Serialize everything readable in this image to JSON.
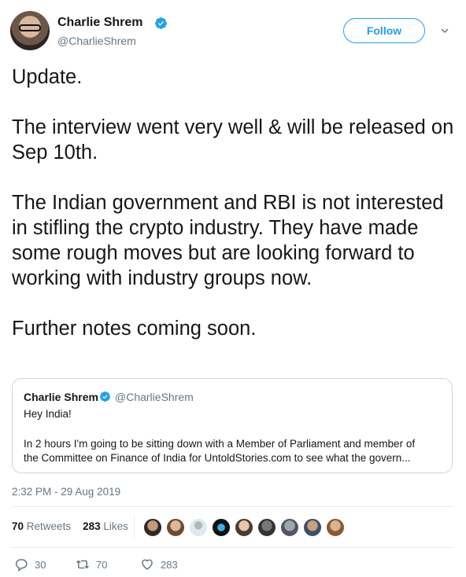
{
  "author": {
    "name": "Charlie Shrem",
    "handle": "@CharlieShrem",
    "verified": true
  },
  "follow_label": "Follow",
  "tweet": {
    "paragraphs": [
      "Update.",
      "The interview went very well & will be released on Sep 10th.",
      "The Indian government and RBI is not interested in stifling the crypto industry. They have made some rough moves but are looking forward to working with industry groups now.",
      "Further notes coming soon."
    ],
    "timestamp": "2:32 PM - 29 Aug 2019"
  },
  "quoted": {
    "name": "Charlie Shrem",
    "handle": "@CharlieShrem",
    "line1": "Hey India!",
    "line2": "In 2 hours I'm going to be sitting down with a Member of Parliament and member of",
    "line3": "the Committee on Finance of India for UntoldStories.com to see what the govern..."
  },
  "stats": {
    "retweets_count": "70",
    "retweets_label": "Retweets",
    "likes_count": "283",
    "likes_label": "Likes"
  },
  "actions": {
    "reply_count": "30",
    "retweet_count": "70",
    "like_count": "283"
  },
  "colors": {
    "accent": "#1da1f2",
    "secondary_text": "#657786",
    "border": "#ccd6dd"
  }
}
